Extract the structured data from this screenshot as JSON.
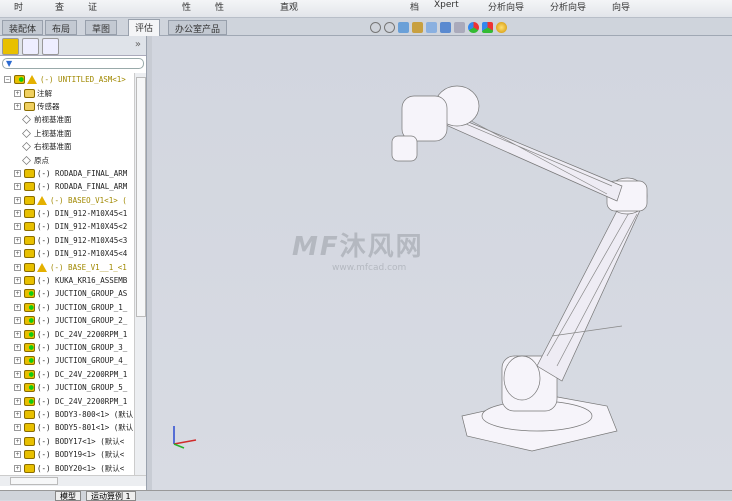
{
  "ribbon": {
    "labels": [
      "时",
      "查",
      "证",
      "性",
      "性",
      "直观",
      "档",
      "Xpert",
      "分析向导",
      "分析向导",
      "向导"
    ]
  },
  "tabs": [
    {
      "label": "装配体"
    },
    {
      "label": "布局"
    },
    {
      "label": "草图"
    },
    {
      "label": "评估",
      "active": true
    },
    {
      "label": "办公室产品"
    }
  ],
  "panel": {
    "expand_label": "»",
    "tree": [
      {
        "label": "(-) UNTITLED_ASM<1>",
        "warn": true,
        "root": true
      },
      {
        "label": "注解",
        "type": "annotation"
      },
      {
        "label": "传感器",
        "type": "sensor"
      },
      {
        "label": "前视基准面",
        "type": "plane"
      },
      {
        "label": "上视基准面",
        "type": "plane"
      },
      {
        "label": "右视基准面",
        "type": "plane"
      },
      {
        "label": "原点",
        "type": "origin"
      },
      {
        "label": "(-) RODADA_FINAL_ARM"
      },
      {
        "label": "(-) RODADA_FINAL_ARM"
      },
      {
        "label": "(-) BASEO_V1<1> (",
        "warn": true
      },
      {
        "label": "(-) DIN_912-M10X45<1"
      },
      {
        "label": "(-) DIN_912-M10X45<2"
      },
      {
        "label": "(-) DIN_912-M10X45<3"
      },
      {
        "label": "(-) DIN_912-M10X45<4"
      },
      {
        "label": "(-) BASE_V1__1_<1",
        "warn": true
      },
      {
        "label": "(-) KUKA_KR16_ASSEMB"
      },
      {
        "label": "(-) JUCTION_GROUP_AS",
        "green": true
      },
      {
        "label": "(-) JUCTION_GROUP_1_",
        "green": true
      },
      {
        "label": "(-) JUCTION_GROUP_2_",
        "green": true
      },
      {
        "label": "(-) DC_24V_2200RPM_1",
        "green": true
      },
      {
        "label": "(-) JUCTION_GROUP_3_",
        "green": true
      },
      {
        "label": "(-) JUCTION_GROUP_4_",
        "green": true
      },
      {
        "label": "(-) DC_24V_2200RPM_1",
        "green": true
      },
      {
        "label": "(-) JUCTION_GROUP_5_",
        "green": true
      },
      {
        "label": "(-) DC_24V_2200RPM_1",
        "green": true
      },
      {
        "label": "(-) BODY3-800<1> (默认"
      },
      {
        "label": "(-) BODY5-801<1> (默认"
      },
      {
        "label": "(-) BODY17<1> (默认<"
      },
      {
        "label": "(-) BODY19<1> (默认<"
      },
      {
        "label": "(-) BODY20<1> (默认<"
      }
    ]
  },
  "watermark": {
    "name": "沐风网",
    "url": "www.mfcad.com"
  },
  "bottom_tabs": [
    {
      "label": "模型"
    },
    {
      "label": "运动算例 1"
    }
  ],
  "colors": {
    "viewport": "#d4d8e0",
    "model": "#f4f2f8",
    "accent_yellow": "#e8c000"
  }
}
